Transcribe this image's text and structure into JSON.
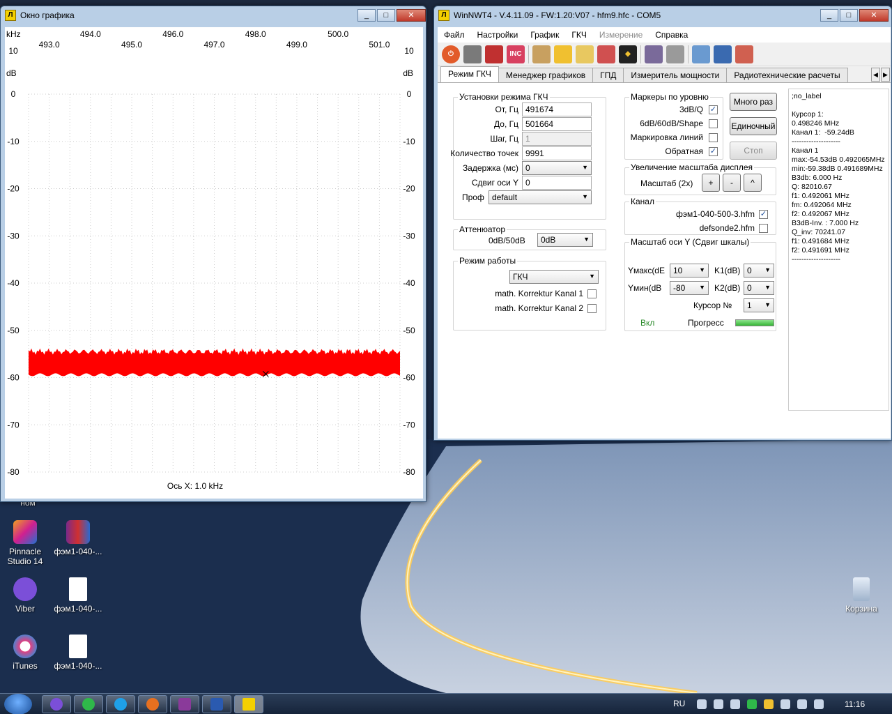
{
  "colors": {
    "trace": "#ff0000",
    "grid": "#cccccc",
    "accent": "#3a6ea5"
  },
  "desktop": {
    "partial_label": "ном",
    "icons": [
      {
        "label": "Pinnacle Studio 14",
        "icon": "pinnacle-studio-icon"
      },
      {
        "label": "фэм1-040-...",
        "icon": "archive-icon"
      },
      {
        "label": "Viber",
        "icon": "viber-icon"
      },
      {
        "label": "фэм1-040-...",
        "icon": "file-icon"
      },
      {
        "label": "iTunes",
        "icon": "itunes-icon"
      },
      {
        "label": "фэм1-040-...",
        "icon": "file-icon"
      },
      {
        "label": "Корзина",
        "icon": "recycle-bin-icon"
      }
    ]
  },
  "graph_window": {
    "title": "Окно графика",
    "x_unit": "kHz",
    "y_unit": "dB",
    "x_axis_label": "Ось X: 1.0 kHz",
    "buttons": {
      "minimize": "_",
      "maximize": "□",
      "close": "✕"
    }
  },
  "chart_data": {
    "type": "line",
    "x_unit": "kHz",
    "y_unit": "dB",
    "x_range": [
      492.5,
      501.5
    ],
    "y_range": [
      -80,
      10
    ],
    "x_ticks_upper": [
      "494.0",
      "496.0",
      "498.0",
      "500.0"
    ],
    "x_ticks_lower": [
      "493.0",
      "495.0",
      "497.0",
      "499.0",
      "501.0"
    ],
    "x_tick_values_upper": [
      494,
      496,
      498,
      500
    ],
    "x_tick_values_lower": [
      493,
      495,
      497,
      499,
      501
    ],
    "y_ticks": [
      10,
      0,
      -10,
      -20,
      -30,
      -40,
      -50,
      -60,
      -70,
      -80
    ],
    "series": [
      {
        "x_start": 492.5,
        "x_end": 501.5,
        "y_min": -59.4,
        "y_max": -54.5
      }
    ],
    "marker": {
      "x": 498.246,
      "y": -59.24
    },
    "xlabel": "Ось X: 1.0 kHz",
    "grid": true
  },
  "nwt_window": {
    "title": "WinNWT4 - V.4.11.09 - FW:1.20:V07 - hfm9.hfc - COM5",
    "menu": [
      {
        "label": "Файл",
        "disabled": false
      },
      {
        "label": "Настройки",
        "disabled": false
      },
      {
        "label": "График",
        "disabled": false
      },
      {
        "label": "ГКЧ",
        "disabled": false
      },
      {
        "label": "Измерение",
        "disabled": true
      },
      {
        "label": "Справка",
        "disabled": false
      }
    ],
    "tabs": [
      "Режим ГКЧ",
      "Менеджер графиков",
      "ГПД",
      "Измеритель мощности",
      "Радиотехнические расчеты"
    ],
    "sweep_settings": {
      "title": "Установки режима ГКЧ",
      "from_label": "От, Гц",
      "from_value": "491674",
      "to_label": "До, Гц",
      "to_value": "501664",
      "step_label": "Шаг, Гц",
      "step_value": "1",
      "points_label": "Количество точек",
      "points_value": "9991",
      "delay_label": "Задержка (мс)",
      "delay_value": "0",
      "yshift_label": "Сдвиг оси Y",
      "yshift_value": "0",
      "profile_label": "Проф",
      "profile_value": "default"
    },
    "attenuator": {
      "title": "Аттенюатор",
      "label": "0dB/50dB",
      "value": "0dB"
    },
    "mode": {
      "title": "Режим работы",
      "value": "ГКЧ",
      "corr1": "math. Korrektur Kanal 1",
      "corr2": "math. Korrektur Kanal 2"
    },
    "level_markers": {
      "title": "Маркеры по уровню",
      "items": [
        {
          "label": "3dB/Q",
          "checked": true
        },
        {
          "label": "6dB/60dB/Shape",
          "checked": false
        },
        {
          "label": "Маркировка линий",
          "checked": false
        },
        {
          "label": "Обратная",
          "checked": true
        }
      ]
    },
    "buttons": {
      "multi": "Много раз",
      "single": "Единочный",
      "stop": "Стоп"
    },
    "zoom": {
      "title": "Увеличение масштаба дисплея",
      "label": "Масштаб (2x)",
      "plus": "+",
      "minus": "-",
      "up": "^"
    },
    "channel": {
      "title": "Канал",
      "items": [
        {
          "label": "фэм1-040-500-3.hfm",
          "checked": true
        },
        {
          "label": "defsonde2.hfm",
          "checked": false
        }
      ]
    },
    "yscale": {
      "title": "Масштаб оси Y (Сдвиг шкалы)",
      "ymax_label": "Yмакс(dE",
      "ymax_value": "10",
      "ymin_label": "Yмин(dB",
      "ymin_value": "-80",
      "k1_label": "K1(dB)",
      "k1_value": "0",
      "k2_label": "K2(dB)",
      "k2_value": "0",
      "cursor_label": "Курсор №",
      "cursor_value": "1",
      "on_label": "Вкл",
      "progress_label": "Прогресс",
      "progress": 1.0
    },
    "info_text": ";no_label\n\nКурсор 1:\n0.498246 MHz\nКанал 1:  -59.24dB\n--------------------\nКанал 1\nmax:-54.53dB 0.492065MHz\nmin:-59.38dB 0.491689MHz\nB3db: 6.000 Hz\nQ: 82010.67\nf1: 0.492061 MHz\nfm: 0.492064 MHz\nf2: 0.492067 MHz\nB3dB-Inv. : 7.000 Hz\nQ_inv: 70241.07\nf1: 0.491684 MHz\nf2: 0.491691 MHz\n--------------------"
  },
  "taskbar": {
    "lang": "RU",
    "time": "11:16"
  }
}
